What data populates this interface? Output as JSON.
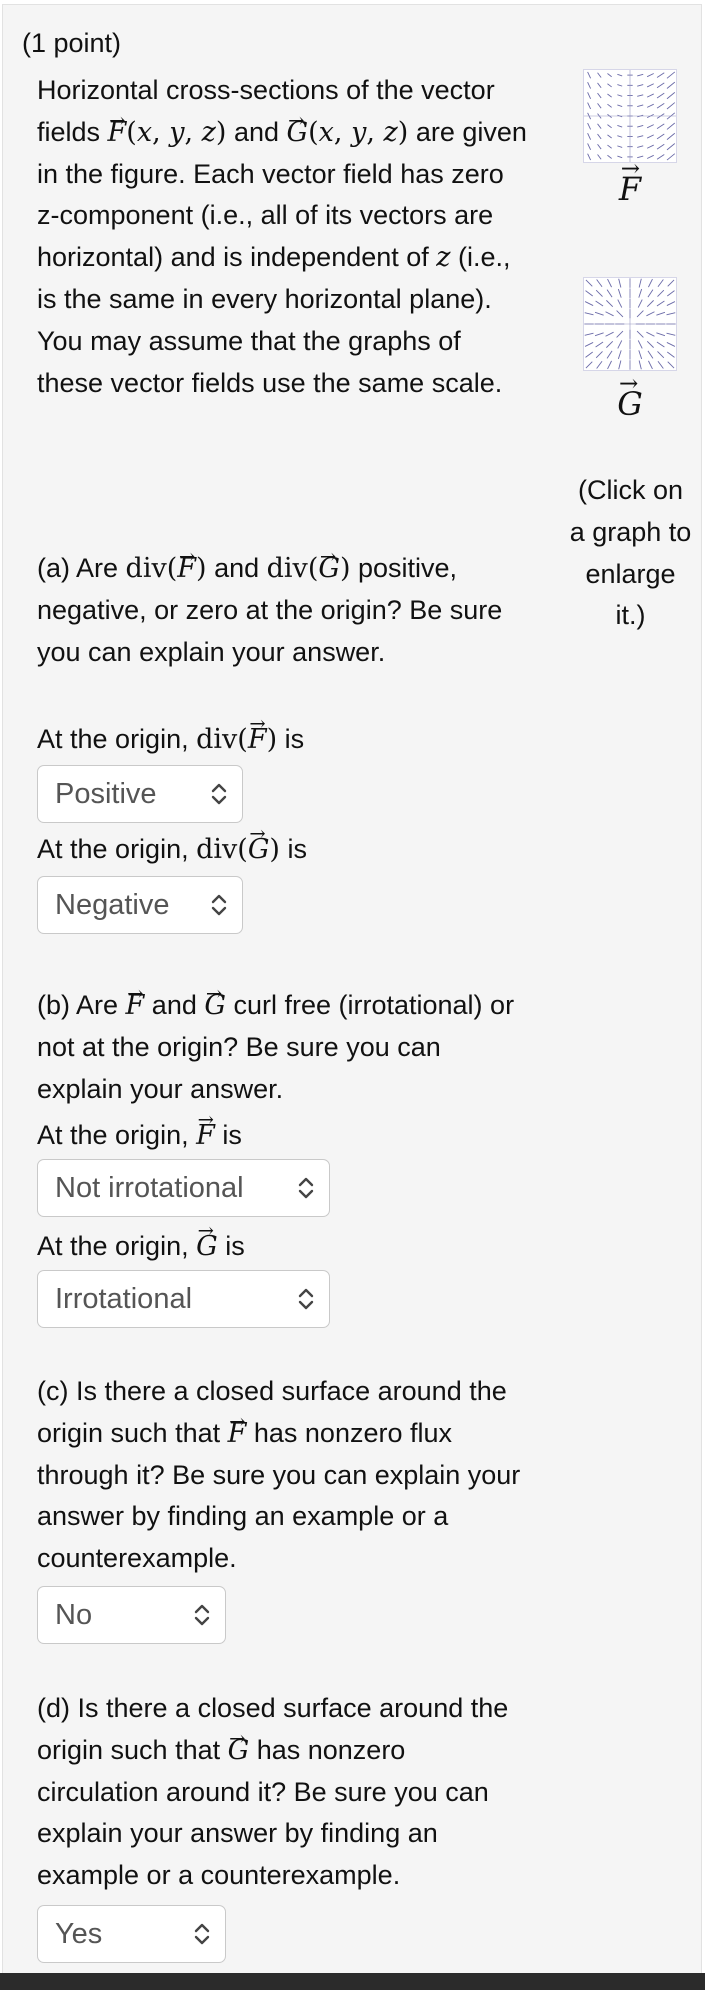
{
  "question": {
    "points": "(1 point)",
    "intro": {
      "t1": "Horizontal cross-sections of the vector fields",
      "t2": "and",
      "t3": "are given in the figure. Each vector field has zero z-component (i.e., all of its vectors are horizontal) and is independent of",
      "t4": "(i.e., is the same in every horizontal plane). You may assume that the graphs of these vector fields use the same scale."
    },
    "part_a": {
      "q1": "(a) Are",
      "q2": "and",
      "q3": "positive, negative, or zero at the origin? Be sure you can explain your answer.",
      "label_f_pre": "At the origin,",
      "label_f_post": "is",
      "select_f": "Positive",
      "label_g_pre": "At the origin,",
      "label_g_post": "is",
      "select_g": "Negative"
    },
    "part_b": {
      "q1": "(b) Are",
      "q2": "and",
      "q3": "curl free (irrotational) or not at the origin? Be sure you can explain your answer.",
      "label_f_pre": "At the origin,",
      "label_f_post": "is",
      "select_f": "Not irrotational",
      "label_g_pre": "At the origin,",
      "label_g_post": "is",
      "select_g": "Irrotational"
    },
    "part_c": {
      "q1": "(c) Is there a closed surface around the origin such that",
      "q2": "has nonzero flux through it? Be sure you can explain your answer by finding an example or a counterexample.",
      "select": "No"
    },
    "part_d": {
      "q1": "(d) Is there a closed surface around the origin such that",
      "q2": "has nonzero circulation around it? Be sure you can explain your answer by finding an example or a counterexample.",
      "select": "Yes"
    }
  },
  "figures": {
    "f_label": "F",
    "g_label": "G",
    "click_note": "(Click on a graph to enlarge it.)"
  },
  "colors": {
    "panel_bg": "#f5f5f5",
    "arrow": "#6a6aa8",
    "select_text": "#555555"
  },
  "icons": [
    "chevron-updown-icon"
  ]
}
